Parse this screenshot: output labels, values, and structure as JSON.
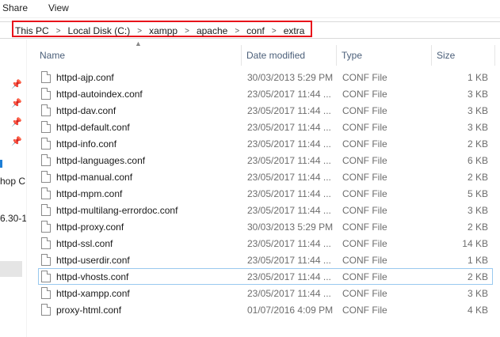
{
  "ribbon": {
    "tabs": [
      "Share",
      "View"
    ]
  },
  "breadcrumb": [
    "This PC",
    "Local Disk (C:)",
    "xampp",
    "apache",
    "conf",
    "extra"
  ],
  "breadcrumb_separator": ">",
  "highlight_color": "#e8131b",
  "nav": {
    "fragments": [
      "hop C",
      "6.30-1"
    ]
  },
  "columns": {
    "name": "Name",
    "date": "Date modified",
    "type": "Type",
    "size": "Size"
  },
  "files": [
    {
      "name": "httpd-ajp.conf",
      "date": "30/03/2013 5:29 PM",
      "type": "CONF File",
      "size": "1 KB"
    },
    {
      "name": "httpd-autoindex.conf",
      "date": "23/05/2017 11:44 ...",
      "type": "CONF File",
      "size": "3 KB"
    },
    {
      "name": "httpd-dav.conf",
      "date": "23/05/2017 11:44 ...",
      "type": "CONF File",
      "size": "3 KB"
    },
    {
      "name": "httpd-default.conf",
      "date": "23/05/2017 11:44 ...",
      "type": "CONF File",
      "size": "3 KB"
    },
    {
      "name": "httpd-info.conf",
      "date": "23/05/2017 11:44 ...",
      "type": "CONF File",
      "size": "2 KB"
    },
    {
      "name": "httpd-languages.conf",
      "date": "23/05/2017 11:44 ...",
      "type": "CONF File",
      "size": "6 KB"
    },
    {
      "name": "httpd-manual.conf",
      "date": "23/05/2017 11:44 ...",
      "type": "CONF File",
      "size": "2 KB"
    },
    {
      "name": "httpd-mpm.conf",
      "date": "23/05/2017 11:44 ...",
      "type": "CONF File",
      "size": "5 KB"
    },
    {
      "name": "httpd-multilang-errordoc.conf",
      "date": "23/05/2017 11:44 ...",
      "type": "CONF File",
      "size": "3 KB"
    },
    {
      "name": "httpd-proxy.conf",
      "date": "30/03/2013 5:29 PM",
      "type": "CONF File",
      "size": "2 KB"
    },
    {
      "name": "httpd-ssl.conf",
      "date": "23/05/2017 11:44 ...",
      "type": "CONF File",
      "size": "14 KB"
    },
    {
      "name": "httpd-userdir.conf",
      "date": "23/05/2017 11:44 ...",
      "type": "CONF File",
      "size": "1 KB"
    },
    {
      "name": "httpd-vhosts.conf",
      "date": "23/05/2017 11:44 ...",
      "type": "CONF File",
      "size": "2 KB",
      "selected": true
    },
    {
      "name": "httpd-xampp.conf",
      "date": "23/05/2017 11:44 ...",
      "type": "CONF File",
      "size": "3 KB"
    },
    {
      "name": "proxy-html.conf",
      "date": "01/07/2016 4:09 PM",
      "type": "CONF File",
      "size": "4 KB"
    }
  ]
}
